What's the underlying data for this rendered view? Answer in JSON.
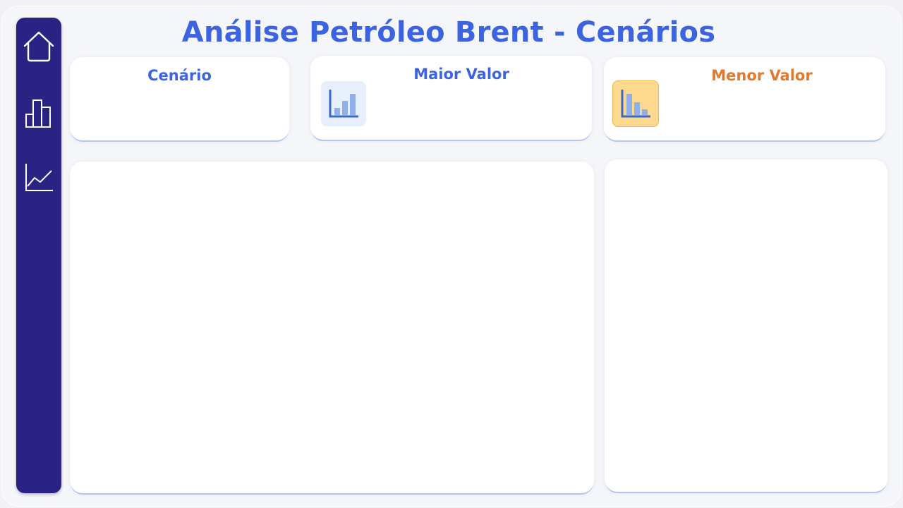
{
  "page": {
    "title": "Análise Petróleo Brent - Cenários"
  },
  "sidebar": {
    "items": [
      {
        "icon": "home-icon"
      },
      {
        "icon": "bar-chart-icon"
      },
      {
        "icon": "line-chart-icon"
      }
    ]
  },
  "cards": {
    "scenario": {
      "title": "Cenário"
    },
    "max_value": {
      "title": "Maior Valor",
      "icon": "bar-chart-up-icon",
      "icon_bg": "#e8effc"
    },
    "min_value": {
      "title": "Menor Valor",
      "icon": "bar-chart-down-icon",
      "icon_bg": "#fdd990"
    }
  },
  "colors": {
    "accent": "#3d64e0",
    "sidebar": "#2a2383",
    "min_title": "#e07a2e"
  }
}
